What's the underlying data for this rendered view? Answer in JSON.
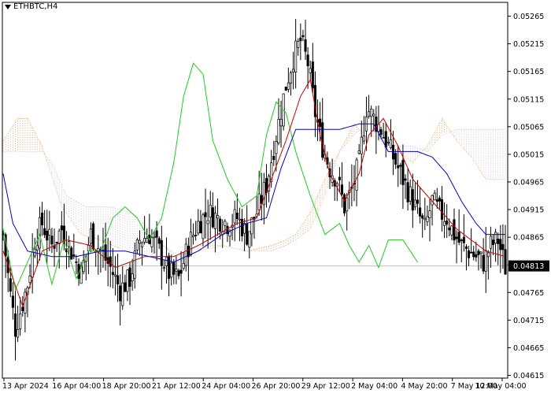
{
  "window": {
    "symbol_title": "ETHBTC,H4"
  },
  "chart_data": {
    "type": "candlestick",
    "title": "ETHBTC,H4",
    "current_price": "0.04813",
    "ylim": [
      0.0461,
      0.0529
    ],
    "y_ticks": [
      "0.05265",
      "0.05215",
      "0.05165",
      "0.05115",
      "0.05065",
      "0.05015",
      "0.04965",
      "0.04915",
      "0.04865",
      "0.04815",
      "0.04765",
      "0.04715",
      "0.04665",
      "0.04615"
    ],
    "x_ticks": [
      "13 Apr 2024",
      "16 Apr 04:00",
      "18 Apr 20:00",
      "21 Apr 12:00",
      "24 Apr 04:00",
      "26 Apr 20:00",
      "29 Apr 12:00",
      "2 May 04:00",
      "4 May 20:00",
      "7 May 12:00",
      "10 May 04:00"
    ],
    "close_anchors": [
      [
        0,
        0.0487
      ],
      [
        3,
        0.0476
      ],
      [
        5,
        0.047
      ],
      [
        7,
        0.0473
      ],
      [
        10,
        0.0478
      ],
      [
        13,
        0.0486
      ],
      [
        16,
        0.0489
      ],
      [
        20,
        0.0485
      ],
      [
        24,
        0.0488
      ],
      [
        28,
        0.0484
      ],
      [
        32,
        0.048
      ],
      [
        36,
        0.0487
      ],
      [
        40,
        0.0484
      ],
      [
        44,
        0.0481
      ],
      [
        48,
        0.0477
      ],
      [
        52,
        0.0479
      ],
      [
        56,
        0.0486
      ],
      [
        60,
        0.0487
      ],
      [
        64,
        0.0484
      ],
      [
        68,
        0.048
      ],
      [
        72,
        0.0479
      ],
      [
        76,
        0.0485
      ],
      [
        80,
        0.0489
      ],
      [
        84,
        0.0491
      ],
      [
        88,
        0.049
      ],
      [
        92,
        0.0489
      ],
      [
        96,
        0.049
      ],
      [
        100,
        0.0487
      ],
      [
        104,
        0.0491
      ],
      [
        108,
        0.0496
      ],
      [
        112,
        0.0505
      ],
      [
        116,
        0.0514
      ],
      [
        119,
        0.0519
      ],
      [
        122,
        0.0522
      ],
      [
        125,
        0.0518
      ],
      [
        128,
        0.0509
      ],
      [
        131,
        0.0503
      ],
      [
        134,
        0.0499
      ],
      [
        137,
        0.0497
      ],
      [
        140,
        0.0492
      ],
      [
        143,
        0.0495
      ],
      [
        146,
        0.05
      ],
      [
        149,
        0.051
      ],
      [
        152,
        0.0508
      ],
      [
        155,
        0.0506
      ],
      [
        158,
        0.0503
      ],
      [
        161,
        0.05
      ],
      [
        164,
        0.0497
      ],
      [
        167,
        0.0494
      ],
      [
        170,
        0.0491
      ],
      [
        173,
        0.0488
      ],
      [
        176,
        0.0493
      ],
      [
        179,
        0.0491
      ],
      [
        182,
        0.049
      ],
      [
        185,
        0.0487
      ],
      [
        188,
        0.0485
      ],
      [
        191,
        0.0484
      ],
      [
        194,
        0.0483
      ],
      [
        197,
        0.0482
      ],
      [
        200,
        0.0485
      ],
      [
        203,
        0.0486
      ],
      [
        206,
        0.0481
      ]
    ],
    "tenkan_anchors": [
      [
        0,
        0.0484
      ],
      [
        8,
        0.0474
      ],
      [
        16,
        0.0484
      ],
      [
        26,
        0.0486
      ],
      [
        36,
        0.0485
      ],
      [
        46,
        0.0481
      ],
      [
        58,
        0.0483
      ],
      [
        70,
        0.0483
      ],
      [
        80,
        0.0485
      ],
      [
        88,
        0.0487
      ],
      [
        96,
        0.0489
      ],
      [
        104,
        0.049
      ],
      [
        110,
        0.0497
      ],
      [
        116,
        0.0504
      ],
      [
        122,
        0.0512
      ],
      [
        126,
        0.0515
      ],
      [
        130,
        0.0505
      ],
      [
        134,
        0.0498
      ],
      [
        140,
        0.0493
      ],
      [
        146,
        0.0498
      ],
      [
        150,
        0.0505
      ],
      [
        156,
        0.0508
      ],
      [
        162,
        0.0503
      ],
      [
        168,
        0.0497
      ],
      [
        174,
        0.0494
      ],
      [
        180,
        0.0491
      ],
      [
        186,
        0.0488
      ],
      [
        192,
        0.0486
      ],
      [
        198,
        0.0484
      ],
      [
        206,
        0.0483
      ]
    ],
    "kijun_anchors": [
      [
        0,
        0.0498
      ],
      [
        4,
        0.0489
      ],
      [
        10,
        0.0484
      ],
      [
        20,
        0.0483
      ],
      [
        30,
        0.0483
      ],
      [
        40,
        0.0484
      ],
      [
        50,
        0.0484
      ],
      [
        60,
        0.0483
      ],
      [
        70,
        0.0482
      ],
      [
        80,
        0.0484
      ],
      [
        90,
        0.0487
      ],
      [
        100,
        0.0489
      ],
      [
        108,
        0.049
      ],
      [
        114,
        0.0499
      ],
      [
        120,
        0.0506
      ],
      [
        126,
        0.0506
      ],
      [
        132,
        0.0506
      ],
      [
        138,
        0.0506
      ],
      [
        146,
        0.0507
      ],
      [
        152,
        0.0507
      ],
      [
        158,
        0.0502
      ],
      [
        164,
        0.0502
      ],
      [
        170,
        0.0502
      ],
      [
        176,
        0.0501
      ],
      [
        182,
        0.0498
      ],
      [
        188,
        0.0493
      ],
      [
        194,
        0.0489
      ],
      [
        198,
        0.0487
      ],
      [
        206,
        0.0487
      ]
    ],
    "chikou_anchors": [
      [
        0,
        0.0488
      ],
      [
        5,
        0.0477
      ],
      [
        10,
        0.0482
      ],
      [
        15,
        0.0487
      ],
      [
        20,
        0.0478
      ],
      [
        25,
        0.0486
      ],
      [
        30,
        0.0479
      ],
      [
        35,
        0.0484
      ],
      [
        40,
        0.0484
      ],
      [
        45,
        0.049
      ],
      [
        50,
        0.0492
      ],
      [
        55,
        0.049
      ],
      [
        60,
        0.0486
      ],
      [
        65,
        0.049
      ],
      [
        70,
        0.05
      ],
      [
        74,
        0.0512
      ],
      [
        78,
        0.0518
      ],
      [
        82,
        0.0516
      ],
      [
        86,
        0.0504
      ],
      [
        92,
        0.0497
      ],
      [
        98,
        0.0492
      ],
      [
        104,
        0.0494
      ],
      [
        108,
        0.0505
      ],
      [
        112,
        0.0511
      ],
      [
        116,
        0.0509
      ],
      [
        120,
        0.0502
      ],
      [
        126,
        0.0494
      ],
      [
        132,
        0.0487
      ],
      [
        138,
        0.0489
      ],
      [
        142,
        0.0485
      ],
      [
        146,
        0.0482
      ],
      [
        150,
        0.0485
      ],
      [
        154,
        0.0481
      ],
      [
        158,
        0.0486
      ],
      [
        164,
        0.0486
      ],
      [
        170,
        0.0482
      ]
    ],
    "span_a_anchors": [
      [
        0,
        0.0504
      ],
      [
        6,
        0.0508
      ],
      [
        10,
        0.0508
      ],
      [
        16,
        0.0503
      ],
      [
        24,
        0.0492
      ],
      [
        32,
        0.0487
      ],
      [
        40,
        0.0486
      ],
      [
        50,
        0.0484
      ],
      [
        60,
        0.0483
      ],
      [
        66,
        0.0485
      ],
      [
        72,
        0.0482
      ],
      [
        80,
        0.0484
      ],
      [
        90,
        0.0485
      ],
      [
        100,
        0.0484
      ],
      [
        110,
        0.0485
      ],
      [
        116,
        0.0486
      ],
      [
        120,
        0.0487
      ],
      [
        126,
        0.0491
      ],
      [
        132,
        0.0497
      ],
      [
        138,
        0.0502
      ],
      [
        144,
        0.0507
      ],
      [
        150,
        0.0504
      ],
      [
        156,
        0.0508
      ],
      [
        162,
        0.0502
      ],
      [
        168,
        0.05
      ],
      [
        174,
        0.0503
      ],
      [
        180,
        0.0508
      ],
      [
        186,
        0.0504
      ],
      [
        192,
        0.0501
      ],
      [
        198,
        0.0497
      ],
      [
        206,
        0.0497
      ]
    ],
    "span_b_anchors": [
      [
        0,
        0.0502
      ],
      [
        10,
        0.0502
      ],
      [
        16,
        0.0502
      ],
      [
        20,
        0.05
      ],
      [
        26,
        0.0494
      ],
      [
        34,
        0.0492
      ],
      [
        44,
        0.0492
      ],
      [
        52,
        0.0491
      ],
      [
        60,
        0.0488
      ],
      [
        66,
        0.0485
      ],
      [
        72,
        0.0483
      ],
      [
        80,
        0.0485
      ],
      [
        90,
        0.0485
      ],
      [
        100,
        0.0484
      ],
      [
        110,
        0.0484
      ],
      [
        116,
        0.0485
      ],
      [
        120,
        0.0486
      ],
      [
        126,
        0.0488
      ],
      [
        132,
        0.0494
      ],
      [
        138,
        0.0502
      ],
      [
        146,
        0.0506
      ],
      [
        154,
        0.0504
      ],
      [
        162,
        0.0503
      ],
      [
        168,
        0.0503
      ],
      [
        174,
        0.0502
      ],
      [
        180,
        0.0505
      ],
      [
        186,
        0.0506
      ],
      [
        192,
        0.0506
      ],
      [
        198,
        0.0506
      ],
      [
        206,
        0.0506
      ]
    ],
    "style": {
      "background": "#ffffff",
      "candle": "#000000",
      "tenkan_color": "#cc0000",
      "kijun_color": "#0000cc",
      "chikou_color": "#22cc22",
      "cloud_bull_color": "#f4a460",
      "cloud_bear_color": "#d8bfd8",
      "price_line_color": "#bfbfbf",
      "axis_color": "#000000"
    }
  }
}
